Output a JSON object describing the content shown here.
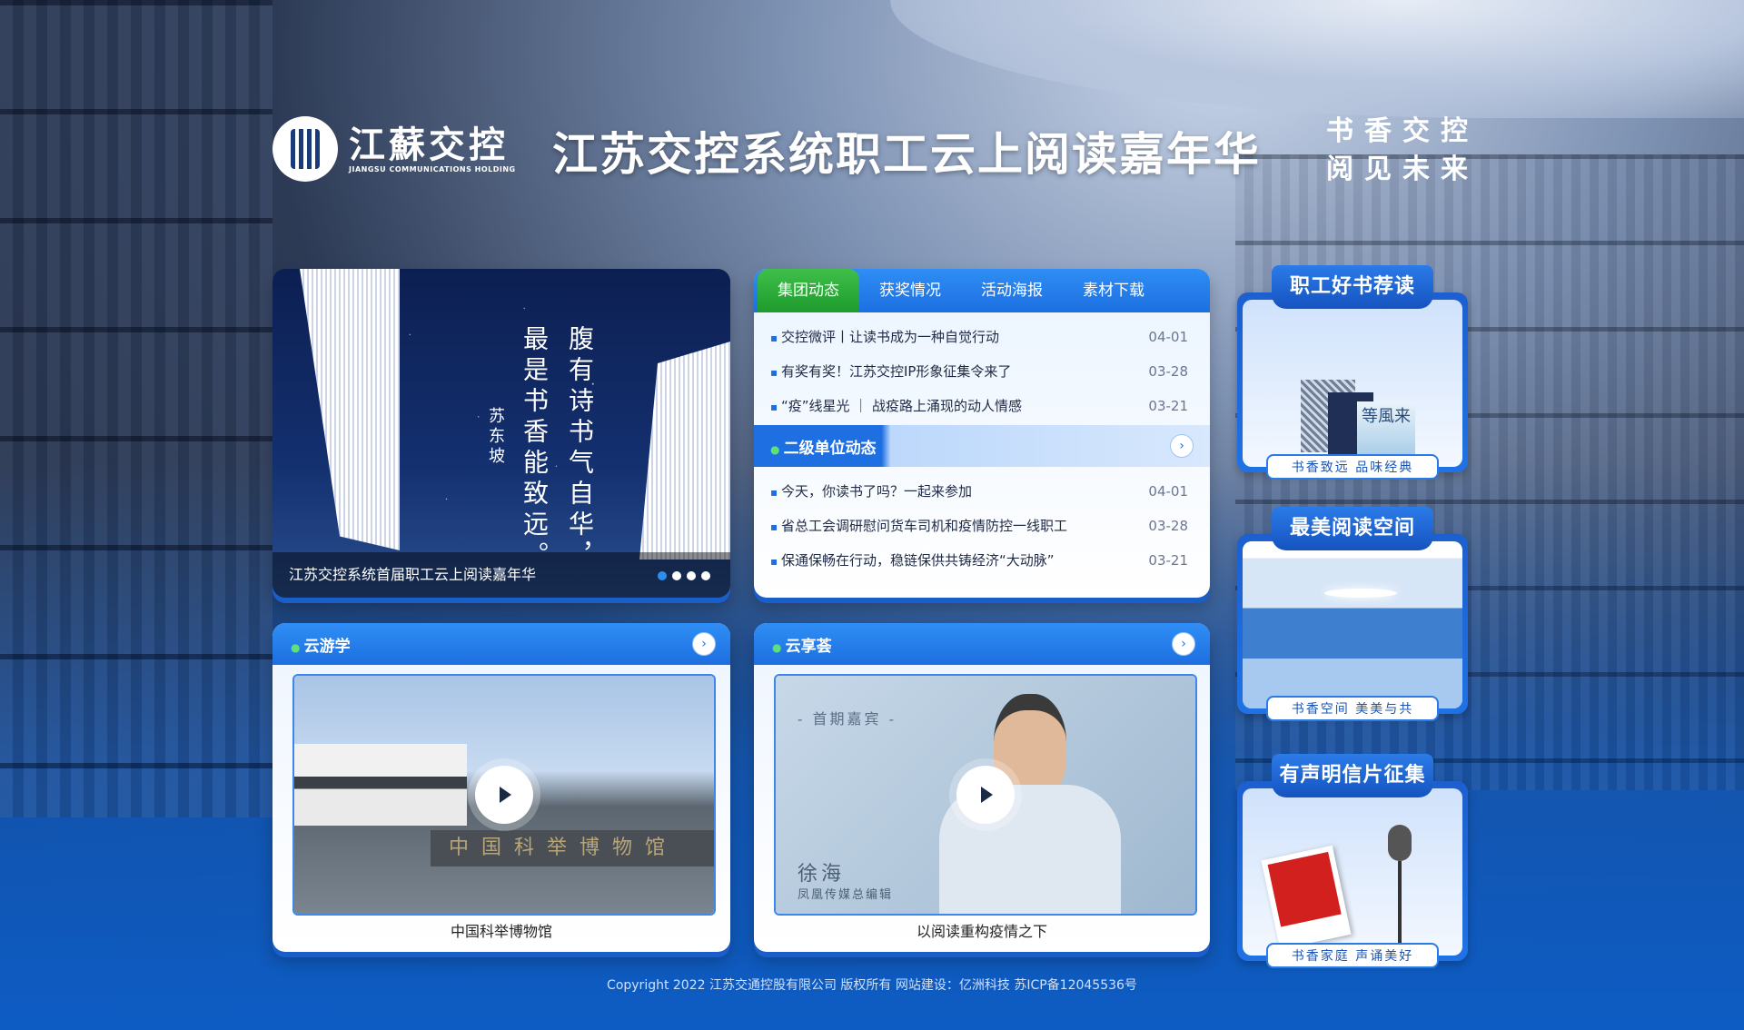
{
  "header": {
    "logo_cn": "江蘇交控",
    "logo_en": "JIANGSU COMMUNICATIONS HOLDING",
    "title": "江苏交控系统职工云上阅读嘉年华",
    "slogan_line1": "书香交控",
    "slogan_line2": "阅见未来"
  },
  "carousel": {
    "poem_col1": "腹有诗书气自华，",
    "poem_col2": "最是书香能致远。",
    "author": "苏东坡",
    "caption": "江苏交控系统首届职工云上阅读嘉年华",
    "slides": 4,
    "active_slide": 1
  },
  "news": {
    "tabs": [
      {
        "label": "集团动态",
        "active": true
      },
      {
        "label": "获奖情况",
        "active": false
      },
      {
        "label": "活动海报",
        "active": false
      },
      {
        "label": "素材下载",
        "active": false
      }
    ],
    "group_items": [
      {
        "title": "交控微评丨让读书成为一种自觉行动",
        "date": "04-01"
      },
      {
        "title": "有奖有奖！江苏交控IP形象征集令来了",
        "date": "03-28"
      },
      {
        "title": "“疫”线星光 ｜ 战疫路上涌现的动人情感",
        "date": "03-21"
      }
    ],
    "sub_title": "二级单位动态",
    "sub_items": [
      {
        "title": "今天，你读书了吗？一起来参加",
        "date": "04-01"
      },
      {
        "title": "省总工会调研慰问货车司机和疫情防控一线职工",
        "date": "03-28"
      },
      {
        "title": "保通保畅在行动，稳链保供共铸经济“大动脉”",
        "date": "03-21"
      }
    ]
  },
  "tour": {
    "title": "云游学",
    "museum_sign": "中国科举博物馆",
    "caption": "中国科举博物馆"
  },
  "salon": {
    "title": "云享荟",
    "guest_tag": "- 首期嘉宾 -",
    "guest_name": "徐海",
    "guest_role": "凤凰传媒总编辑",
    "caption": "以阅读重构疫情之下"
  },
  "cards": [
    {
      "title": "职工好书荐读",
      "tag": "书香致远 品味经典",
      "book_text": "等風来"
    },
    {
      "title": "最美阅读空间",
      "tag": "书香空间 美美与共"
    },
    {
      "title": "有声明信片征集",
      "tag": "书香家庭 声诵美好"
    }
  ],
  "footer": {
    "text": "Copyright 2022 江苏交通控股有限公司 版权所有 网站建设：亿洲科技 苏ICP备12045536号"
  },
  "colors": {
    "accent_blue": "#1d6fe0",
    "active_tab_green": "#1e9b2c"
  }
}
